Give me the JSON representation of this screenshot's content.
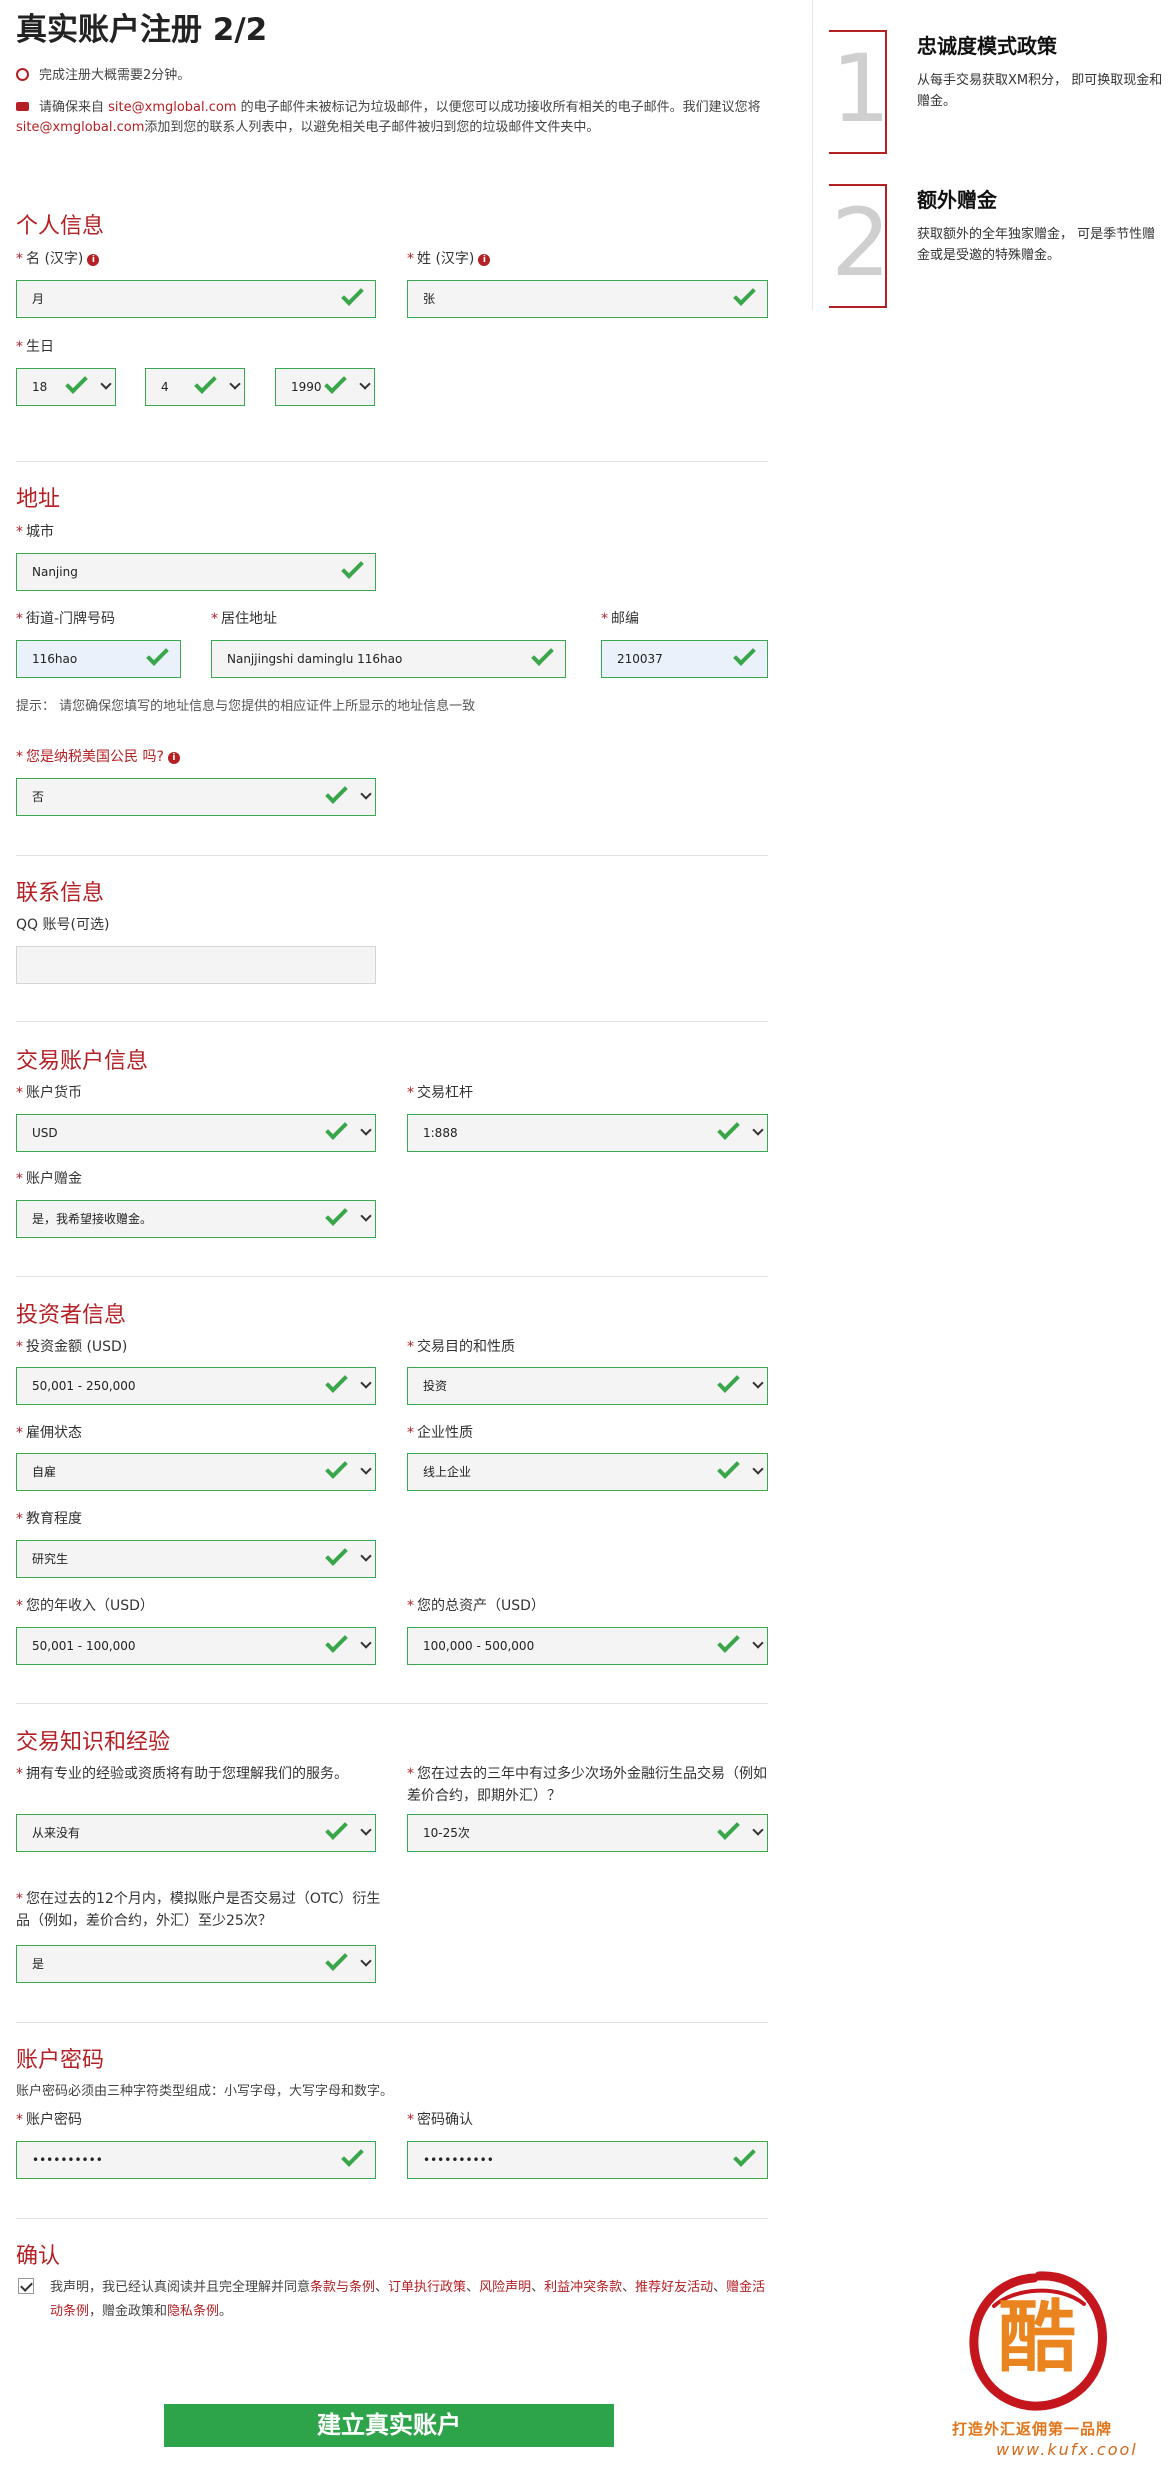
{
  "header": {
    "title": "真实账户注册 2/2"
  },
  "notices": {
    "time": "完成注册大概需要2分钟。",
    "email_pre": "请确保来自 ",
    "email_addr": "site@xmglobal.com",
    "email_mid": " 的电子邮件未被标记为垃圾邮件，以便您可以成功接收所有相关的电子邮件。我们建议您将 ",
    "email_addr2": "site@xmglobal.com",
    "email_post": "添加到您的联系人列表中，以避免相关电子邮件被归到您的垃圾邮件文件夹中。"
  },
  "personal": {
    "title": "个人信息",
    "first_name_label": "名 (汉字)",
    "first_name_value": "月",
    "last_name_label": "姓 (汉字)",
    "last_name_value": "张",
    "birthday_label": "生日",
    "day": "18",
    "month": "4",
    "year": "1990"
  },
  "address": {
    "title": "地址",
    "city_label": "城市",
    "city_value": "Nanjing",
    "street_label": "街道-门牌号码",
    "street_value": "116hao",
    "residence_label": "居住地址",
    "residence_value": "Nanjjingshi daminglu 116hao",
    "postcode_label": "邮编",
    "postcode_value": "210037",
    "hint": "提示： 请您确保您填写的地址信息与您提供的相应证件上所显示的地址信息一致",
    "us_citizen_label": "您是纳税美国公民 吗?",
    "us_citizen_value": "否"
  },
  "contact": {
    "title": "联系信息",
    "qq_label": "QQ 账号(可选)",
    "qq_value": ""
  },
  "trading": {
    "title": "交易账户信息",
    "currency_label": "账户货币",
    "currency_value": "USD",
    "leverage_label": "交易杠杆",
    "leverage_value": "1:888",
    "bonus_label": "账户赠金",
    "bonus_value": "是，我希望接收赠金。"
  },
  "investor": {
    "title": "投资者信息",
    "amount_label": "投资金额 (USD)",
    "amount_value": "50,001 - 250,000",
    "purpose_label": "交易目的和性质",
    "purpose_value": "投资",
    "employment_label": "雇佣状态",
    "employment_value": "自雇",
    "business_label": "企业性质",
    "business_value": "线上企业",
    "education_label": "教育程度",
    "education_value": "研究生",
    "income_label": "您的年收入（USD）",
    "income_value": "50,001 - 100,000",
    "assets_label": "您的总资产（USD）",
    "assets_value": "100,000 - 500,000"
  },
  "knowledge": {
    "title": "交易知识和经验",
    "q1_label": "拥有专业的经验或资质将有助于您理解我们的服务。",
    "q1_value": "从来没有",
    "q2_label": "您在过去的三年中有过多少次场外金融衍生品交易（例如差价合约，即期外汇）？",
    "q2_value": "10-25次",
    "q3_label": "您在过去的12个月内，模拟账户是否交易过（OTC）衍生品（例如，差价合约，外汇）至少25次？",
    "q3_value": "是"
  },
  "password": {
    "title": "账户密码",
    "rule": "账户密码必须由三种字符类型组成：小写字母，大写字母和数字。",
    "pwd_label": "账户密码",
    "pwd_value": "••••••••••",
    "confirm_label": "密码确认",
    "confirm_value": "••••••••••"
  },
  "confirm": {
    "title": "确认",
    "text_pre": "我声明，我已经认真阅读并且完全理解并同意",
    "link1": "条款与条例",
    "sep1": "、",
    "link2": "订单执行政策",
    "sep2": "、",
    "link3": "风险声明",
    "sep3": "、",
    "link4": "利益冲突条款",
    "sep4": "、",
    "link5": "推荐好友活动",
    "sep5": "、",
    "link6": "赠金活动条例",
    "text_mid": "，赠金政策和",
    "link7": "隐私条例",
    "text_end": "。",
    "submit_label": "建立真实账户"
  },
  "sidebar": {
    "promo1_num": "1",
    "promo1_title": "忠诚度模式政策",
    "promo1_text": "从每手交易获取XM积分， 即可换取现金和赠金。",
    "promo2_num": "2",
    "promo2_title": "额外赠金",
    "promo2_text": "获取额外的全年独家赠金， 可是季节性赠金或是受邀的特殊赠金。"
  },
  "watermark": {
    "char": "酷",
    "tagline": "打造外汇返佣第一品牌",
    "url": "www.kufx.cool"
  },
  "colors": {
    "accent": "#b52024",
    "valid": "#3aa64a",
    "submit": "#2ea44a"
  }
}
